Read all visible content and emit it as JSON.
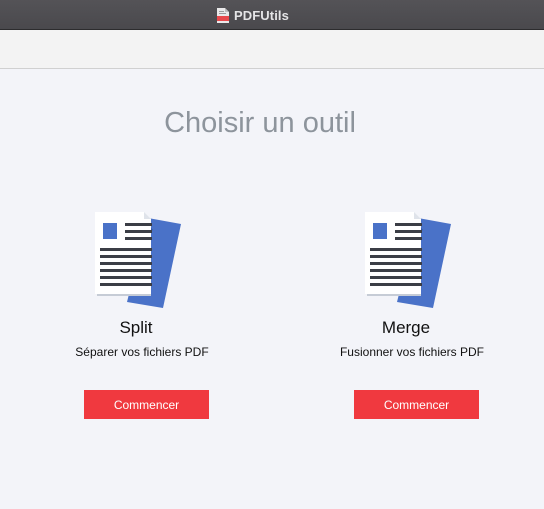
{
  "window": {
    "title": "PDFUtils",
    "app_icon": "pdf-file-icon"
  },
  "main": {
    "heading": "Choisir un outil",
    "tools": [
      {
        "icon": "document-icon",
        "title": "Split",
        "description": "Séparer vos fichiers PDF",
        "button_label": "Commencer"
      },
      {
        "icon": "document-icon",
        "title": "Merge",
        "description": "Fusionner vos fichiers PDF",
        "button_label": "Commencer"
      }
    ]
  },
  "colors": {
    "accent": "#f0393f",
    "doc_blue": "#4a72c8",
    "heading": "#8d949c"
  }
}
